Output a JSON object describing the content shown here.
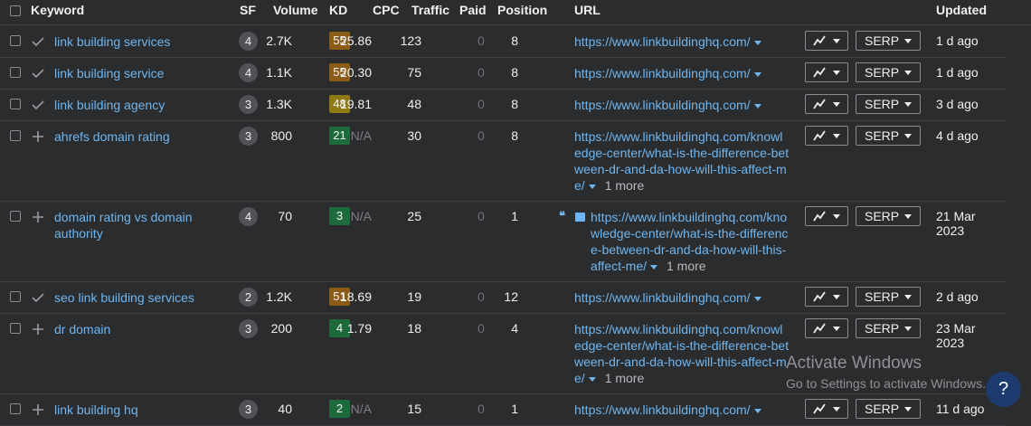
{
  "header": {
    "keyword": "Keyword",
    "sf": "SF",
    "volume": "Volume",
    "kd": "KD",
    "cpc": "CPC",
    "traffic": "Traffic",
    "paid": "Paid",
    "position": "Position",
    "url": "URL",
    "updated": "Updated"
  },
  "colors": {
    "kd_orange": "#8a5c17",
    "kd_yellow": "#8f7a12",
    "kd_green": "#1f6a3a",
    "link": "#6fb6f0"
  },
  "rows": [
    {
      "action_icon": "check-icon",
      "keyword": "link building services",
      "sf": "4",
      "volume": "2.7K",
      "kd": "55",
      "cpc": "25.86",
      "traffic": "123",
      "paid": "0",
      "position": "8",
      "url": "https://www.linkbuildinghq.com/",
      "serp": "SERP",
      "updated": "1 d ago"
    },
    {
      "action_icon": "check-icon",
      "keyword": "link building service",
      "sf": "4",
      "volume": "1.1K",
      "kd": "55",
      "cpc": "20.30",
      "traffic": "75",
      "paid": "0",
      "position": "8",
      "url": "https://www.linkbuildinghq.com/",
      "serp": "SERP",
      "updated": "1 d ago"
    },
    {
      "action_icon": "check-icon",
      "keyword": "link building agency",
      "sf": "3",
      "volume": "1.3K",
      "kd": "48",
      "cpc": "19.81",
      "traffic": "48",
      "paid": "0",
      "position": "8",
      "url": "https://www.linkbuildinghq.com/",
      "serp": "SERP",
      "updated": "3 d ago"
    },
    {
      "action_icon": "plus-icon",
      "keyword": "ahrefs domain rating",
      "sf": "3",
      "volume": "800",
      "kd": "21",
      "cpc": "N/A",
      "traffic": "30",
      "paid": "0",
      "position": "8",
      "url": "https://www.linkbuildinghq.com/knowledge-center/what-is-the-difference-between-dr-and-da-how-will-this-affect-me/",
      "more": "1 more",
      "serp": "SERP",
      "updated": "4 d ago"
    },
    {
      "action_icon": "plus-icon",
      "keyword": "domain rating vs domain authority",
      "sf": "4",
      "volume": "70",
      "kd": "3",
      "cpc": "N/A",
      "traffic": "25",
      "paid": "0",
      "position": "1",
      "url": "https://www.linkbuildinghq.com/knowledge-center/what-is-the-difference-between-dr-and-da-how-will-this-affect-me/",
      "more": "1 more",
      "serp": "SERP",
      "updated": "21 Mar 2023"
    },
    {
      "action_icon": "check-icon",
      "keyword": "seo link building services",
      "sf": "2",
      "volume": "1.2K",
      "kd": "51",
      "cpc": "18.69",
      "traffic": "19",
      "paid": "0",
      "position": "12",
      "url": "https://www.linkbuildinghq.com/",
      "serp": "SERP",
      "updated": "2 d ago"
    },
    {
      "action_icon": "plus-icon",
      "keyword": "dr domain",
      "sf": "3",
      "volume": "200",
      "kd": "4",
      "cpc": "1.79",
      "traffic": "18",
      "paid": "0",
      "position": "4",
      "url": "https://www.linkbuildinghq.com/knowledge-center/what-is-the-difference-between-dr-and-da-how-will-this-affect-me/",
      "more": "1 more",
      "serp": "SERP",
      "updated": "23 Mar 2023"
    },
    {
      "action_icon": "plus-icon",
      "keyword": "link building hq",
      "sf": "3",
      "volume": "40",
      "kd": "2",
      "cpc": "N/A",
      "traffic": "15",
      "paid": "0",
      "position": "1",
      "url": "https://www.linkbuildinghq.com/",
      "serp": "SERP",
      "updated": "11 d ago"
    }
  ],
  "watermark": {
    "title": "Activate Windows",
    "subtitle": "Go to Settings to activate Windows."
  },
  "help": {
    "label": "?"
  }
}
